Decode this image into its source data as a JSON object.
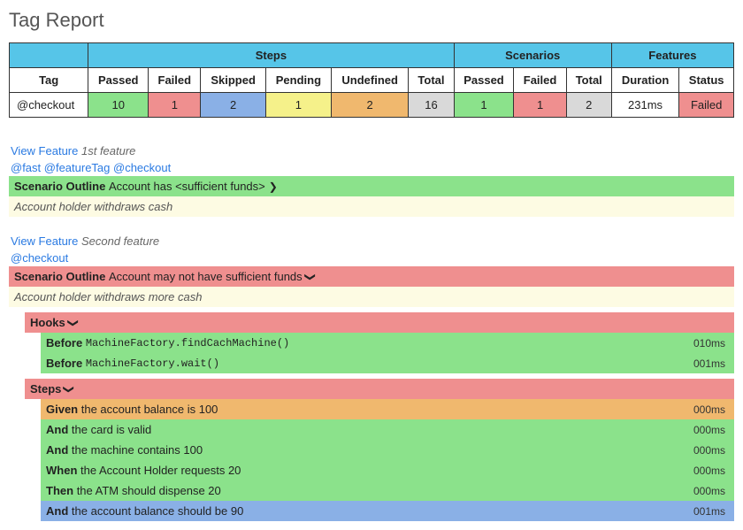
{
  "title": "Tag Report",
  "table": {
    "groups": {
      "steps": "Steps",
      "scenarios": "Scenarios",
      "features": "Features"
    },
    "cols": {
      "tag": "Tag",
      "passed": "Passed",
      "failed": "Failed",
      "skipped": "Skipped",
      "pending": "Pending",
      "undefined": "Undefined",
      "total": "Total",
      "spassed": "Passed",
      "sfailed": "Failed",
      "stotal": "Total",
      "duration": "Duration",
      "status": "Status"
    },
    "row": {
      "tag": "@checkout",
      "steps": {
        "passed": "10",
        "failed": "1",
        "skipped": "2",
        "pending": "1",
        "undefined": "2",
        "total": "16"
      },
      "scenarios": {
        "passed": "1",
        "failed": "1",
        "total": "2"
      },
      "features": {
        "duration": "231ms",
        "status": "Failed"
      }
    }
  },
  "viewFeature": "View Feature",
  "feature1": {
    "name": "1st feature",
    "tags": "@fast @featureTag @checkout",
    "scenarioLabel": "Scenario Outline",
    "scenarioText": "Account has <sufficient funds>",
    "desc": "Account holder withdraws cash"
  },
  "feature2": {
    "name": "Second feature",
    "tags": "@checkout",
    "scenarioLabel": "Scenario Outline",
    "scenarioText": "Account may not have sufficient funds",
    "desc": "Account holder withdraws more cash",
    "hooksLabel": "Hooks",
    "hooks": [
      {
        "kw": "Before",
        "text": "MachineFactory.findCachMachine()",
        "dur": "010ms"
      },
      {
        "kw": "Before",
        "text": "MachineFactory.wait()",
        "dur": "001ms"
      }
    ],
    "stepsLabel": "Steps",
    "steps": [
      {
        "kw": "Given",
        "text": "the account balance is 100",
        "dur": "000ms",
        "color": "orange"
      },
      {
        "kw": "And",
        "text": "the card is valid",
        "dur": "000ms",
        "color": "green"
      },
      {
        "kw": "And",
        "text": "the machine contains 100",
        "dur": "000ms",
        "color": "green"
      },
      {
        "kw": "When",
        "text": "the Account Holder requests 20",
        "dur": "000ms",
        "color": "green"
      },
      {
        "kw": "Then",
        "text": "the ATM should dispense 20",
        "dur": "000ms",
        "color": "green"
      },
      {
        "kw": "And",
        "text": "the account balance should be 90",
        "dur": "001ms",
        "color": "blue"
      }
    ]
  },
  "icons": {
    "right": "❯",
    "down": "❯"
  }
}
